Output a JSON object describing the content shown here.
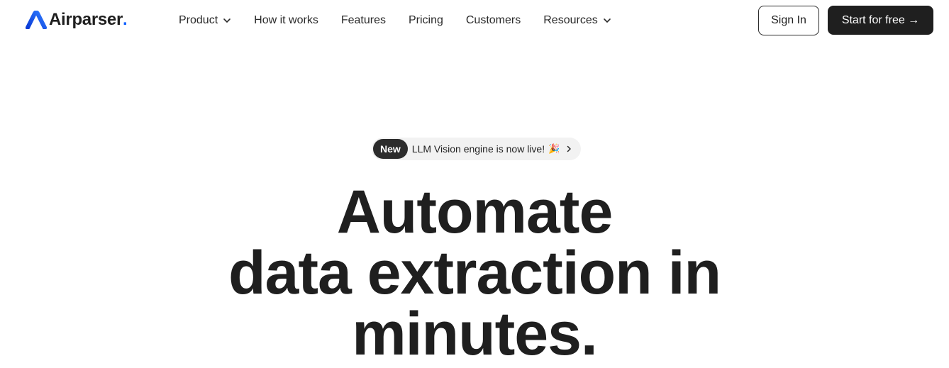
{
  "header": {
    "logo": {
      "text": "Airparser",
      "dot": ".",
      "brand_color": "#1463ff"
    },
    "nav": [
      {
        "label": "Product",
        "has_dropdown": true
      },
      {
        "label": "How it works",
        "has_dropdown": false
      },
      {
        "label": "Features",
        "has_dropdown": false
      },
      {
        "label": "Pricing",
        "has_dropdown": false
      },
      {
        "label": "Customers",
        "has_dropdown": false
      },
      {
        "label": "Resources",
        "has_dropdown": true
      }
    ],
    "sign_in_label": "Sign In",
    "start_label": "Start for free →"
  },
  "announcement": {
    "badge": "New",
    "text": "LLM Vision engine is now live!",
    "icon": "party-popper-icon",
    "emoji": "🎉"
  },
  "hero": {
    "lines": [
      "Automate",
      "data extraction in",
      "minutes."
    ]
  },
  "colors": {
    "text": "#1f1f1f",
    "button_dark": "#1f1f1f",
    "pill_bg": "#f2f2f2"
  }
}
